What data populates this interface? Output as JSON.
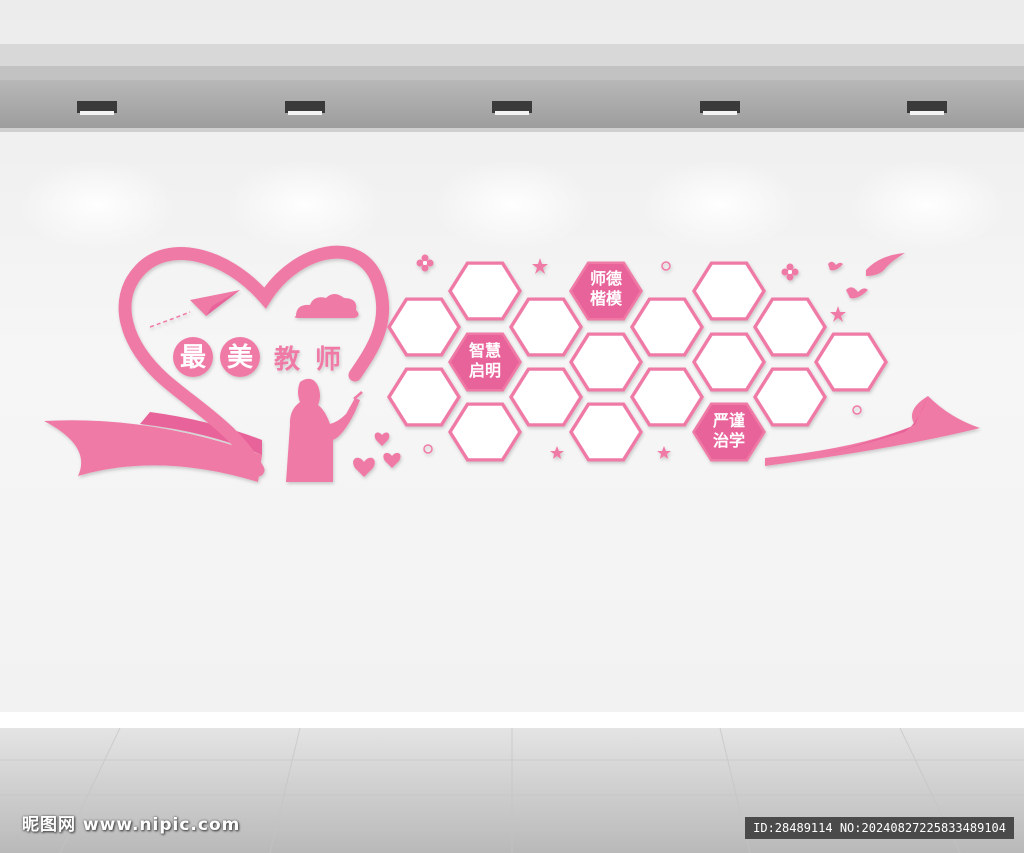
{
  "title": {
    "chars": [
      "最",
      "美",
      "教",
      "师"
    ]
  },
  "hex_labels": [
    {
      "line1": "师德",
      "line2": "楷模"
    },
    {
      "line1": "智慧",
      "line2": "启明"
    },
    {
      "line1": "严谨",
      "line2": "治学"
    }
  ],
  "watermark": {
    "site_name": "昵图网",
    "site_url": "www.nipic.com",
    "id_text": "ID:28489114 NO:20240827225833489104"
  },
  "colors": {
    "accent": "#f07aa6",
    "accent_dark": "#e8649a",
    "wall": "#f4f4f4",
    "ceiling": "#a9a9a9",
    "floor": "#cfcfcf"
  },
  "icons": [
    "spotlight-icon",
    "paper-plane-icon",
    "cloud-icon",
    "heart-icon",
    "star-icon",
    "flower-icon",
    "dove-icon",
    "teacher-silhouette-icon"
  ]
}
